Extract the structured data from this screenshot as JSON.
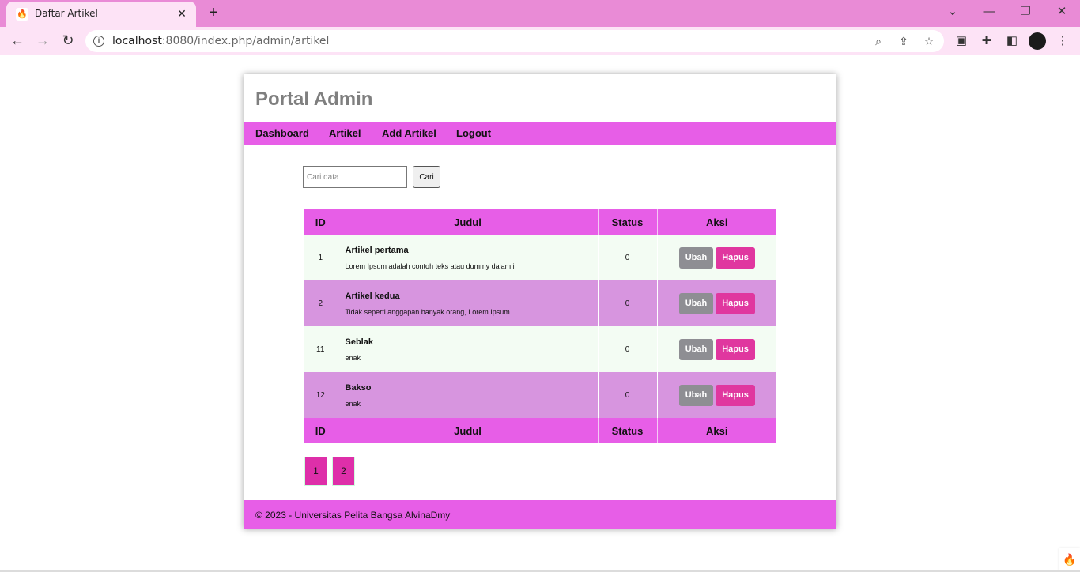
{
  "browser": {
    "tab_title": "Daftar Artikel",
    "favicon": "flame-icon",
    "url_host": "localhost",
    "url_rest": ":8080/index.php/admin/artikel"
  },
  "site": {
    "title": "Portal Admin",
    "nav": [
      "Dashboard",
      "Artikel",
      "Add Artikel",
      "Logout"
    ]
  },
  "search": {
    "placeholder": "Cari data",
    "button": "Cari"
  },
  "table": {
    "headers": [
      "ID",
      "Judul",
      "Status",
      "Aksi"
    ],
    "rows": [
      {
        "id": "1",
        "title": "Artikel pertama",
        "desc": "Lorem Ipsum adalah contoh teks atau dummy dalam i",
        "status": "0"
      },
      {
        "id": "2",
        "title": "Artikel kedua",
        "desc": "Tidak seperti anggapan banyak orang, Lorem Ipsum",
        "status": "0"
      },
      {
        "id": "11",
        "title": "Seblak",
        "desc": "enak",
        "status": "0"
      },
      {
        "id": "12",
        "title": "Bakso",
        "desc": "enak",
        "status": "0"
      }
    ],
    "edit_label": "Ubah",
    "delete_label": "Hapus"
  },
  "pagination": [
    "1",
    "2"
  ],
  "footer": "© 2023 - Universitas Pelita Bangsa AlvinaDmy",
  "colors": {
    "accent": "#e75ee7",
    "row_light": "#f3fcf3",
    "row_dark": "#d795df",
    "delete_button": "#e0379f",
    "edit_button": "#8e8e93"
  }
}
